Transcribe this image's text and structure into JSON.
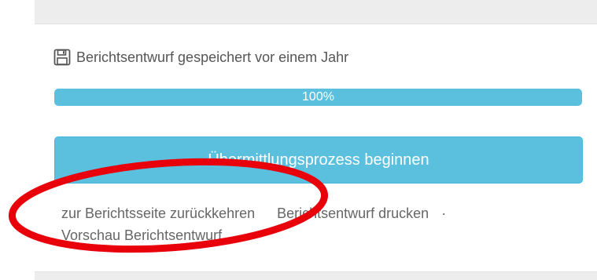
{
  "save_status": {
    "icon": "floppy-disk-icon",
    "text": "Berichtsentwurf gespeichert vor einem Jahr"
  },
  "progress": {
    "value_percent": 100,
    "label": "100%"
  },
  "submit_button": {
    "label": "Übermittlungsprozess beginnen",
    "color": "#5bc0de"
  },
  "links": {
    "back_to_report": "zur Berichtsseite zurückkehren",
    "print_draft": "Berichtsentwurf drucken",
    "separator": "·",
    "preview_draft": "Vorschau Berichtsentwurf"
  },
  "annotation": {
    "shape": "ellipse",
    "color": "#e8000b"
  }
}
